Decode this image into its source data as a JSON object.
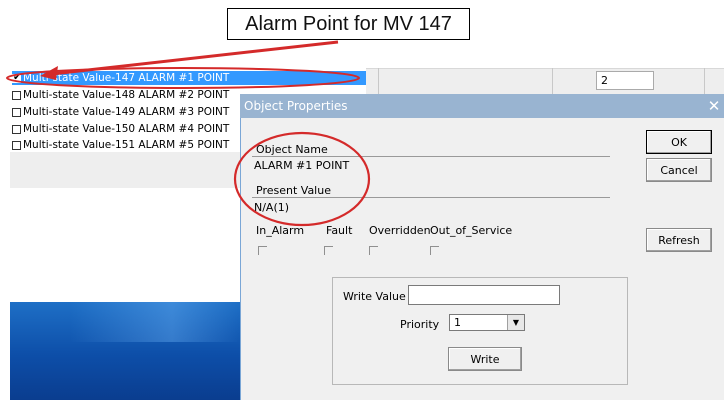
{
  "callout": {
    "text": "Alarm Point for MV 147"
  },
  "object_list": {
    "items": [
      {
        "label": "Multi-state Value-147 ALARM #1 POINT",
        "checked": true,
        "selected": true
      },
      {
        "label": "Multi-state Value-148 ALARM #2 POINT",
        "checked": false,
        "selected": false
      },
      {
        "label": "Multi-state Value-149 ALARM #3 POINT",
        "checked": false,
        "selected": false
      },
      {
        "label": "Multi-state Value-150 ALARM #4 POINT",
        "checked": false,
        "selected": false
      },
      {
        "label": "Multi-state Value-151 ALARM #5 POINT",
        "checked": false,
        "selected": false
      }
    ]
  },
  "background_app": {
    "value_field": "2"
  },
  "dialog": {
    "title": "Object Properties",
    "close_glyph": "✕",
    "object_name_label": "Object Name",
    "object_name_value": "ALARM #1 POINT",
    "present_value_label": "Present Value",
    "present_value_value": "N/A(1)",
    "flags": [
      "In_Alarm",
      "Fault",
      "Overridden",
      "Out_of_Service"
    ],
    "ok_label": "OK",
    "cancel_label": "Cancel",
    "refresh_label": "Refresh",
    "write_value_label": "Write Value",
    "write_value": "",
    "priority_label": "Priority",
    "priority_value": "1",
    "write_label": "Write"
  },
  "colors": {
    "annotation_red": "#d42a2a",
    "selection_blue": "#3399ff",
    "titlebar": "#99b4d1"
  }
}
